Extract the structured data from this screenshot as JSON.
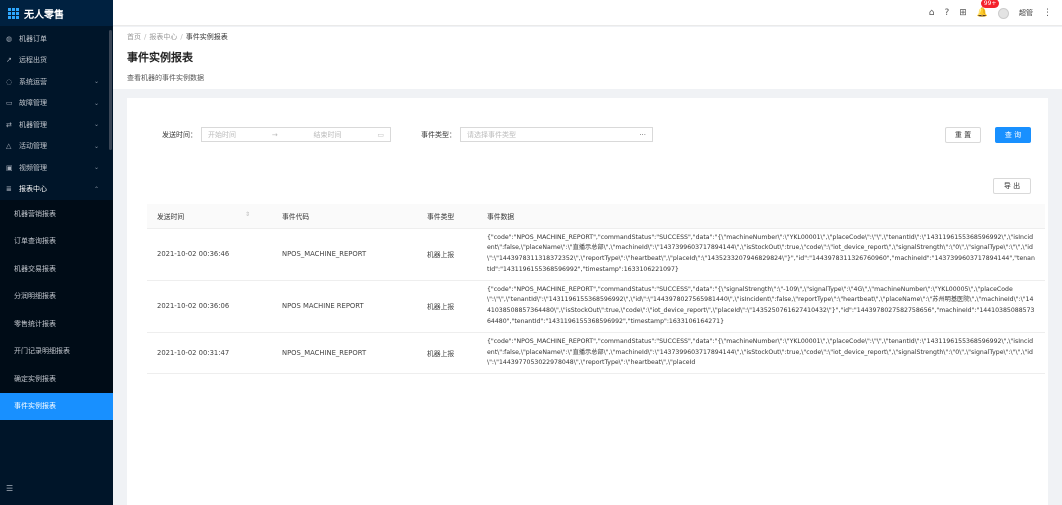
{
  "app": {
    "name": "无人零售"
  },
  "sidebar": {
    "items": [
      {
        "label": "机器订单",
        "icon": "◍"
      },
      {
        "label": "远程出货",
        "icon": "↗"
      },
      {
        "label": "系统运营",
        "icon": "◌",
        "caret": "⌄"
      },
      {
        "label": "故障管理",
        "icon": "▭",
        "caret": "⌄"
      },
      {
        "label": "机器管理",
        "icon": "⇄",
        "caret": "⌄"
      },
      {
        "label": "活动管理",
        "icon": "△",
        "caret": "⌄"
      },
      {
        "label": "视频管理",
        "icon": "▣",
        "caret": "⌄"
      },
      {
        "label": "报表中心",
        "icon": "≣",
        "caret": "⌃"
      }
    ],
    "submenu": [
      "机器营销报表",
      "订单查询报表",
      "机器交易报表",
      "分润明细报表",
      "零售统计报表",
      "开门记录明细报表",
      "确定实例报表",
      "事件实例报表"
    ],
    "collapse_icon": "☰"
  },
  "header": {
    "icons": [
      "⌂",
      "?",
      "⊞"
    ],
    "badge": "99+",
    "user": "超管"
  },
  "breadcrumb": [
    "首页",
    "报表中心",
    "事件实例报表"
  ],
  "page": {
    "title": "事件实例报表",
    "description": "查看机器的事件实例数据"
  },
  "filters": {
    "time_label": "发送时间：",
    "start_placeholder": "开始时间",
    "arrow": "→",
    "end_placeholder": "结束时间",
    "type_label": "事件类型：",
    "type_placeholder": "请选择事件类型",
    "ellipsis": "···"
  },
  "buttons": {
    "reset": "重 置",
    "query": "查 询",
    "export": "导 出"
  },
  "table": {
    "columns": [
      "发送时间",
      "事件代码",
      "事件类型",
      "事件数据"
    ],
    "rows": [
      {
        "time": "2021-10-02 00:36:46",
        "code": "NPOS_MACHINE_REPORT",
        "type": "机器上报",
        "data": "{\"code\":\"NPOS_MACHINE_REPORT\",\"commandStatus\":\"SUCCESS\",\"data\":\"{\\\"machineNumber\\\":\\\"YKL00001\\\",\\\"placeCode\\\":\\\"\\\",\\\"tenantId\\\":\\\"1431196155368596992\\\",\\\"isIncident\\\":false,\\\"placeName\\\":\\\"直播示总部\\\",\\\"machineId\\\":\\\"1437399603717894144\\\",\\\"isStockOut\\\":true,\\\"code\\\":\\\"iot_device_report\\\",\\\"signalStrength\\\":\\\"0\\\",\\\"signalType\\\":\\\"\\\",\\\"id\\\":\\\"1443978311318372352\\\",\\\"reportType\\\":\\\"heartbeat\\\",\\\"placeId\\\":\\\"1435233207946829824\\\"}\",\"id\":\"1443978311326760960\",\"machineId\":\"1437399603717894144\",\"tenantId\":\"1431196155368596992\",\"timestamp\":1633106221097}"
      },
      {
        "time": "2021-10-02 00:36:06",
        "code": "NPOS MACHINE REPORT",
        "type": "机器上报",
        "data": "{\"code\":\"NPOS_MACHINE_REPORT\",\"commandStatus\":\"SUCCESS\",\"data\":\"{\\\"signalStrength\\\":\\\"-109\\\",\\\"signalType\\\":\\\"4G\\\",\\\"machineNumber\\\":\\\"YKL00005\\\",\\\"placeCode\\\":\\\"\\\",\\\"tenantId\\\":\\\"1431196155368596992\\\",\\\"id\\\":\\\"1443978027565981440\\\",\\\"isIncident\\\":false,\\\"reportType\\\":\\\"heartbeat\\\",\\\"placeName\\\":\\\"苏州明基医院\\\",\\\"machineId\\\":\\\"1441038508857364480\\\",\\\"isStockOut\\\":true,\\\"code\\\":\\\"iot_device_report\\\",\\\"placeId\\\":\\\"1435250761627410432\\\"}\",\"id\":\"1443978027582758656\",\"machineId\":\"1441038508857364480\",\"tenantId\":\"1431196155368596992\",\"timestamp\":1633106164271}"
      },
      {
        "time": "2021-10-02 00:31:47",
        "code": "NPOS_MACHINE_REPORT",
        "type": "机器上报",
        "data": "{\"code\":\"NPOS_MACHINE_REPORT\",\"commandStatus\":\"SUCCESS\",\"data\":\"{\\\"machineNumber\\\":\\\"YKL00001\\\",\\\"placeCode\\\":\\\"\\\",\\\"tenantId\\\":\\\"1431196155368596992\\\",\\\"isIncident\\\":false,\\\"placeName\\\":\\\"直播示总部\\\",\\\"machineId\\\":\\\"1437399603717894144\\\",\\\"isStockOut\\\":true,\\\"code\\\":\\\"iot_device_report\\\",\\\"signalStrength\\\":\\\"0\\\",\\\"signalType\\\":\\\"\\\",\\\"id\\\":\\\"1443977053022978048\\\",\\\"reportType\\\":\\\"heartbeat\\\",\\\"placeId"
      }
    ]
  }
}
